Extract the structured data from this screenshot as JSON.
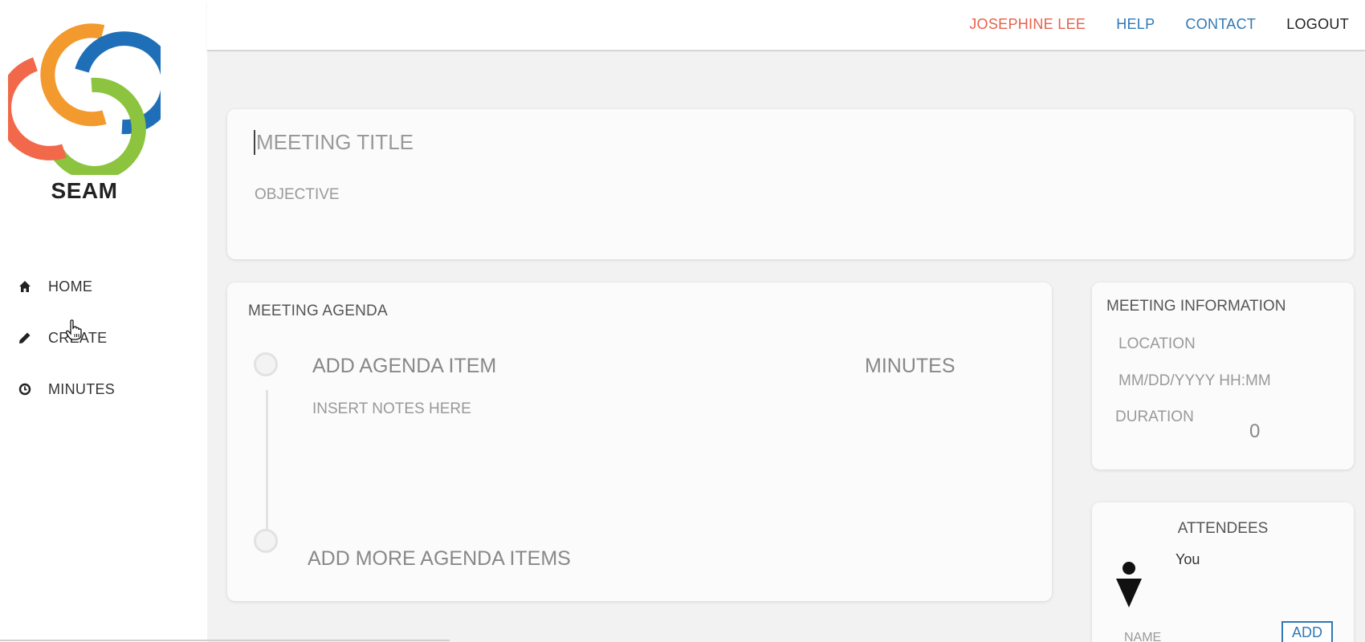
{
  "brand": {
    "name": "SEAM"
  },
  "sidebar": {
    "items": [
      {
        "label": "HOME",
        "icon": "home-icon"
      },
      {
        "label": "CREATE",
        "icon": "pencil-icon"
      },
      {
        "label": "MINUTES",
        "icon": "clock-icon"
      }
    ]
  },
  "header": {
    "user": "JOSEPHINE LEE",
    "help": "HELP",
    "contact": "CONTACT",
    "logout": "LOGOUT"
  },
  "meeting": {
    "title_placeholder": "MEETING TITLE",
    "objective_placeholder": "OBJECTIVE"
  },
  "agenda": {
    "heading": "MEETING AGENDA",
    "item_placeholder": "ADD AGENDA ITEM",
    "minutes_placeholder": "MINUTES",
    "notes_placeholder": "INSERT NOTES HERE",
    "add_more": "ADD MORE AGENDA ITEMS"
  },
  "info": {
    "heading": "MEETING INFORMATION",
    "location_placeholder": "LOCATION",
    "datetime_placeholder": "MM/DD/YYYY HH:MM",
    "duration_label": "DURATION",
    "duration_value": "0"
  },
  "attendees": {
    "heading": "ATTENDEES",
    "you": "You",
    "name_placeholder": "NAME",
    "add_label": "ADD"
  },
  "colors": {
    "accent_red": "#e8604a",
    "link_blue": "#2f78b5",
    "logo_orange": "#f39a2e",
    "logo_blue": "#1f6fb8",
    "logo_green": "#8cc43f",
    "logo_red": "#f2684a"
  }
}
